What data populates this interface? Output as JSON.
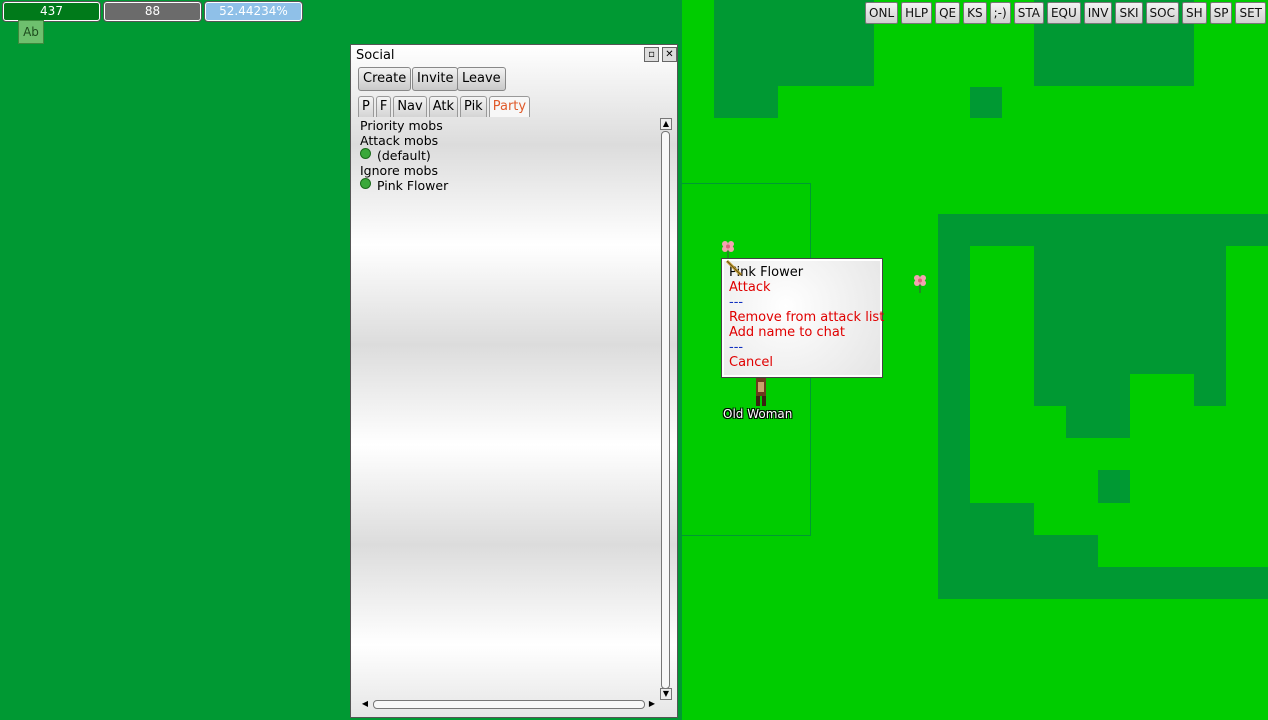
{
  "status": {
    "hp": "437",
    "mp": "88",
    "xp": "52.44234%"
  },
  "ab_label": "Ab",
  "top_buttons": [
    "ONL",
    "HLP",
    "QE",
    "KS",
    ";-)",
    "STA",
    "EQU",
    "INV",
    "SKI",
    "SOC",
    "SH",
    "SP",
    "SET"
  ],
  "social": {
    "title": "Social",
    "buttons": {
      "create": "Create",
      "invite": "Invite",
      "leave": "Leave"
    },
    "tabs": [
      "P",
      "F",
      "Nav",
      "Atk",
      "Pik",
      "Party"
    ],
    "list": {
      "priority": "Priority mobs",
      "attack": "Attack mobs",
      "attack_default": "(default)",
      "ignore": "Ignore mobs",
      "ignore_item": "Pink Flower"
    }
  },
  "popup": {
    "title": "Pink Flower",
    "attack": "Attack",
    "sep1": "---",
    "remove": "Remove from attack list",
    "add_name": "Add name to chat",
    "sep2": "---",
    "cancel": "Cancel"
  },
  "npc_name": "Old Woman"
}
